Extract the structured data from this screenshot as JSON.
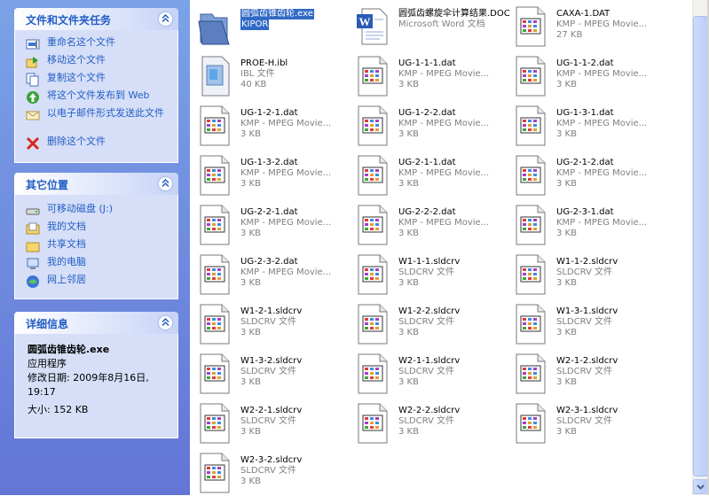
{
  "panels": {
    "tasks": {
      "title": "文件和文件夹任务",
      "items": [
        {
          "label": "重命名这个文件",
          "icon": "rename-icon"
        },
        {
          "label": "移动这个文件",
          "icon": "move-icon"
        },
        {
          "label": "复制这个文件",
          "icon": "copy-icon"
        },
        {
          "label": "将这个文件发布到 Web",
          "icon": "publish-web-icon"
        },
        {
          "label": "以电子邮件形式发送此文件",
          "icon": "email-icon"
        },
        {
          "label": "删除这个文件",
          "icon": "delete-icon"
        }
      ]
    },
    "places": {
      "title": "其它位置",
      "items": [
        {
          "label": "可移动磁盘 (J:)",
          "icon": "removable-disk-icon"
        },
        {
          "label": "我的文档",
          "icon": "my-documents-icon"
        },
        {
          "label": "共享文档",
          "icon": "shared-documents-icon"
        },
        {
          "label": "我的电脑",
          "icon": "my-computer-icon"
        },
        {
          "label": "网上邻居",
          "icon": "network-places-icon"
        }
      ]
    },
    "details": {
      "title": "详细信息",
      "name": "圆弧齿锥齿轮.exe",
      "type": "应用程序",
      "modified": "修改日期: 2009年8月16日, 19:17",
      "size": "大小: 152 KB"
    }
  },
  "files": [
    {
      "name": "圆弧齿锥齿轮.exe",
      "sub": "KIPOR",
      "size": "",
      "kind": "exe"
    },
    {
      "name": "圆弧齿螺旋伞计算结果.DOC",
      "sub": "Microsoft Word 文档",
      "size": "",
      "kind": "doc"
    },
    {
      "name": "CAXA-1.DAT",
      "sub": "KMP - MPEG Movie...",
      "size": "27 KB",
      "kind": "kmp"
    },
    {
      "name": "PROE-H.ibl",
      "sub": "IBL 文件",
      "size": "40 KB",
      "kind": "ibl"
    },
    {
      "name": "UG-1-1-1.dat",
      "sub": "KMP - MPEG Movie...",
      "size": "3 KB",
      "kind": "kmp"
    },
    {
      "name": "UG-1-1-2.dat",
      "sub": "KMP - MPEG Movie...",
      "size": "3 KB",
      "kind": "kmp"
    },
    {
      "name": "UG-1-2-1.dat",
      "sub": "KMP - MPEG Movie...",
      "size": "3 KB",
      "kind": "kmp"
    },
    {
      "name": "UG-1-2-2.dat",
      "sub": "KMP - MPEG Movie...",
      "size": "3 KB",
      "kind": "kmp"
    },
    {
      "name": "UG-1-3-1.dat",
      "sub": "KMP - MPEG Movie...",
      "size": "3 KB",
      "kind": "kmp"
    },
    {
      "name": "UG-1-3-2.dat",
      "sub": "KMP - MPEG Movie...",
      "size": "3 KB",
      "kind": "kmp"
    },
    {
      "name": "UG-2-1-1.dat",
      "sub": "KMP - MPEG Movie...",
      "size": "3 KB",
      "kind": "kmp"
    },
    {
      "name": "UG-2-1-2.dat",
      "sub": "KMP - MPEG Movie...",
      "size": "3 KB",
      "kind": "kmp"
    },
    {
      "name": "UG-2-2-1.dat",
      "sub": "KMP - MPEG Movie...",
      "size": "3 KB",
      "kind": "kmp"
    },
    {
      "name": "UG-2-2-2.dat",
      "sub": "KMP - MPEG Movie...",
      "size": "3 KB",
      "kind": "kmp"
    },
    {
      "name": "UG-2-3-1.dat",
      "sub": "KMP - MPEG Movie...",
      "size": "3 KB",
      "kind": "kmp"
    },
    {
      "name": "UG-2-3-2.dat",
      "sub": "KMP - MPEG Movie...",
      "size": "3 KB",
      "kind": "kmp"
    },
    {
      "name": "W1-1-1.sldcrv",
      "sub": "SLDCRV 文件",
      "size": "3 KB",
      "kind": "kmp"
    },
    {
      "name": "W1-1-2.sldcrv",
      "sub": "SLDCRV 文件",
      "size": "3 KB",
      "kind": "kmp"
    },
    {
      "name": "W1-2-1.sldcrv",
      "sub": "SLDCRV 文件",
      "size": "3 KB",
      "kind": "kmp"
    },
    {
      "name": "W1-2-2.sldcrv",
      "sub": "SLDCRV 文件",
      "size": "3 KB",
      "kind": "kmp"
    },
    {
      "name": "W1-3-1.sldcrv",
      "sub": "SLDCRV 文件",
      "size": "3 KB",
      "kind": "kmp"
    },
    {
      "name": "W1-3-2.sldcrv",
      "sub": "SLDCRV 文件",
      "size": "3 KB",
      "kind": "kmp"
    },
    {
      "name": "W2-1-1.sldcrv",
      "sub": "SLDCRV 文件",
      "size": "3 KB",
      "kind": "kmp"
    },
    {
      "name": "W2-1-2.sldcrv",
      "sub": "SLDCRV 文件",
      "size": "3 KB",
      "kind": "kmp"
    },
    {
      "name": "W2-2-1.sldcrv",
      "sub": "SLDCRV 文件",
      "size": "3 KB",
      "kind": "kmp"
    },
    {
      "name": "W2-2-2.sldcrv",
      "sub": "SLDCRV 文件",
      "size": "3 KB",
      "kind": "kmp"
    },
    {
      "name": "W2-3-1.sldcrv",
      "sub": "SLDCRV 文件",
      "size": "3 KB",
      "kind": "kmp"
    },
    {
      "name": "W2-3-2.sldcrv",
      "sub": "SLDCRV 文件",
      "size": "3 KB",
      "kind": "kmp"
    }
  ],
  "colors": {
    "pane_gradient_top": "#7ba2e7",
    "pane_gradient_bottom": "#6375d6",
    "link_blue": "#215dc6",
    "selection_blue": "#316ac5"
  }
}
